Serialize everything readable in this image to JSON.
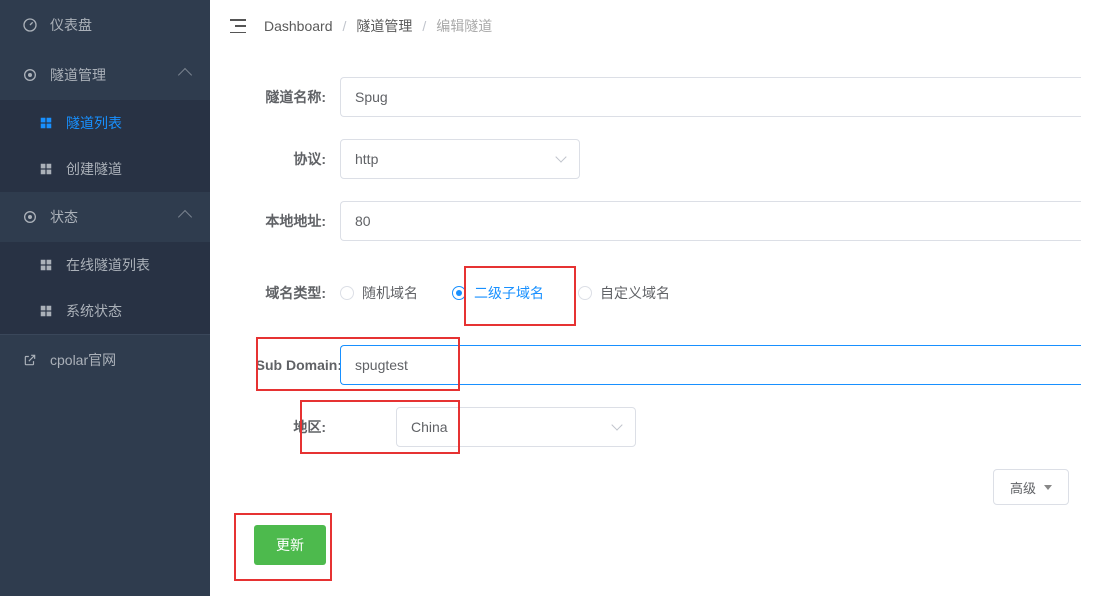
{
  "sidebar": {
    "dashboard": "仪表盘",
    "tunnel_mgmt": "隧道管理",
    "tunnel_list": "隧道列表",
    "create_tunnel": "创建隧道",
    "status": "状态",
    "online_list": "在线隧道列表",
    "sys_status": "系统状态",
    "cpolar_site": "cpolar官网"
  },
  "breadcrumb": {
    "a": "Dashboard",
    "b": "隧道管理",
    "c": "编辑隧道"
  },
  "form": {
    "name_label": "隧道名称:",
    "name_value": "Spug",
    "protocol_label": "协议:",
    "protocol_value": "http",
    "local_addr_label": "本地地址:",
    "local_addr_value": "80",
    "domain_type_label": "域名类型:",
    "domain_opts": {
      "random": "随机域名",
      "subdomain": "二级子域名",
      "custom": "自定义域名"
    },
    "subdomain_label": "Sub Domain:",
    "subdomain_value": "spugtest",
    "region_label": "地区:",
    "region_value": "China"
  },
  "buttons": {
    "advanced": "高级",
    "submit": "更新"
  }
}
